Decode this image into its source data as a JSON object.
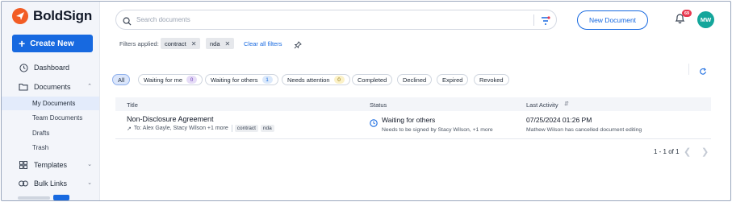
{
  "app": {
    "name": "BoldSign"
  },
  "sidebar": {
    "create_label": "Create New",
    "items": [
      {
        "label": "Dashboard",
        "icon": "clock-icon"
      },
      {
        "label": "Documents",
        "icon": "folder-icon",
        "expanded": true
      },
      {
        "label": "Templates",
        "icon": "grid-icon"
      },
      {
        "label": "Bulk Links",
        "icon": "link-icon"
      }
    ],
    "document_subitems": [
      "My Documents",
      "Team Documents",
      "Drafts",
      "Trash"
    ],
    "active_subitem": "My Documents"
  },
  "header": {
    "search_placeholder": "Search documents",
    "new_document_label": "New Document",
    "notification_count": "69",
    "avatar_initials": "MW"
  },
  "filters": {
    "label": "Filters applied:",
    "chips": [
      "contract",
      "nda"
    ],
    "clear_all_label": "Clear all filters"
  },
  "status_tabs": [
    {
      "label": "All",
      "active": true
    },
    {
      "label": "Waiting for me",
      "count": "0",
      "count_bg": "#e6dcf7",
      "count_color": "#6b3fb8"
    },
    {
      "label": "Waiting for others",
      "count": "1",
      "count_bg": "#dbe9fb",
      "count_color": "#1769e0"
    },
    {
      "label": "Needs attention",
      "count": "0",
      "count_bg": "#fbf1c7",
      "count_color": "#8a6d00"
    },
    {
      "label": "Completed"
    },
    {
      "label": "Declined"
    },
    {
      "label": "Expired"
    },
    {
      "label": "Revoked"
    }
  ],
  "table": {
    "columns": {
      "title": "Title",
      "status": "Status",
      "last_activity": "Last Activity"
    },
    "rows": [
      {
        "title": "Non-Disclosure Agreement",
        "recipients": "To: Alex Gayle, Stacy Wilson +1 more",
        "tags": [
          "contract",
          "nda"
        ],
        "status": "Waiting for others",
        "status_detail": "Needs to be signed by Stacy Wilson, +1 more",
        "last_activity": "07/25/2024 01:26 PM",
        "last_activity_detail": "Mathew Wilson has cancelled document editing"
      }
    ]
  },
  "pagination": {
    "label": "1 - 1 of 1"
  },
  "colors": {
    "brand": "#f25c24",
    "accent": "#1769e0",
    "avatar": "#14a69b"
  }
}
